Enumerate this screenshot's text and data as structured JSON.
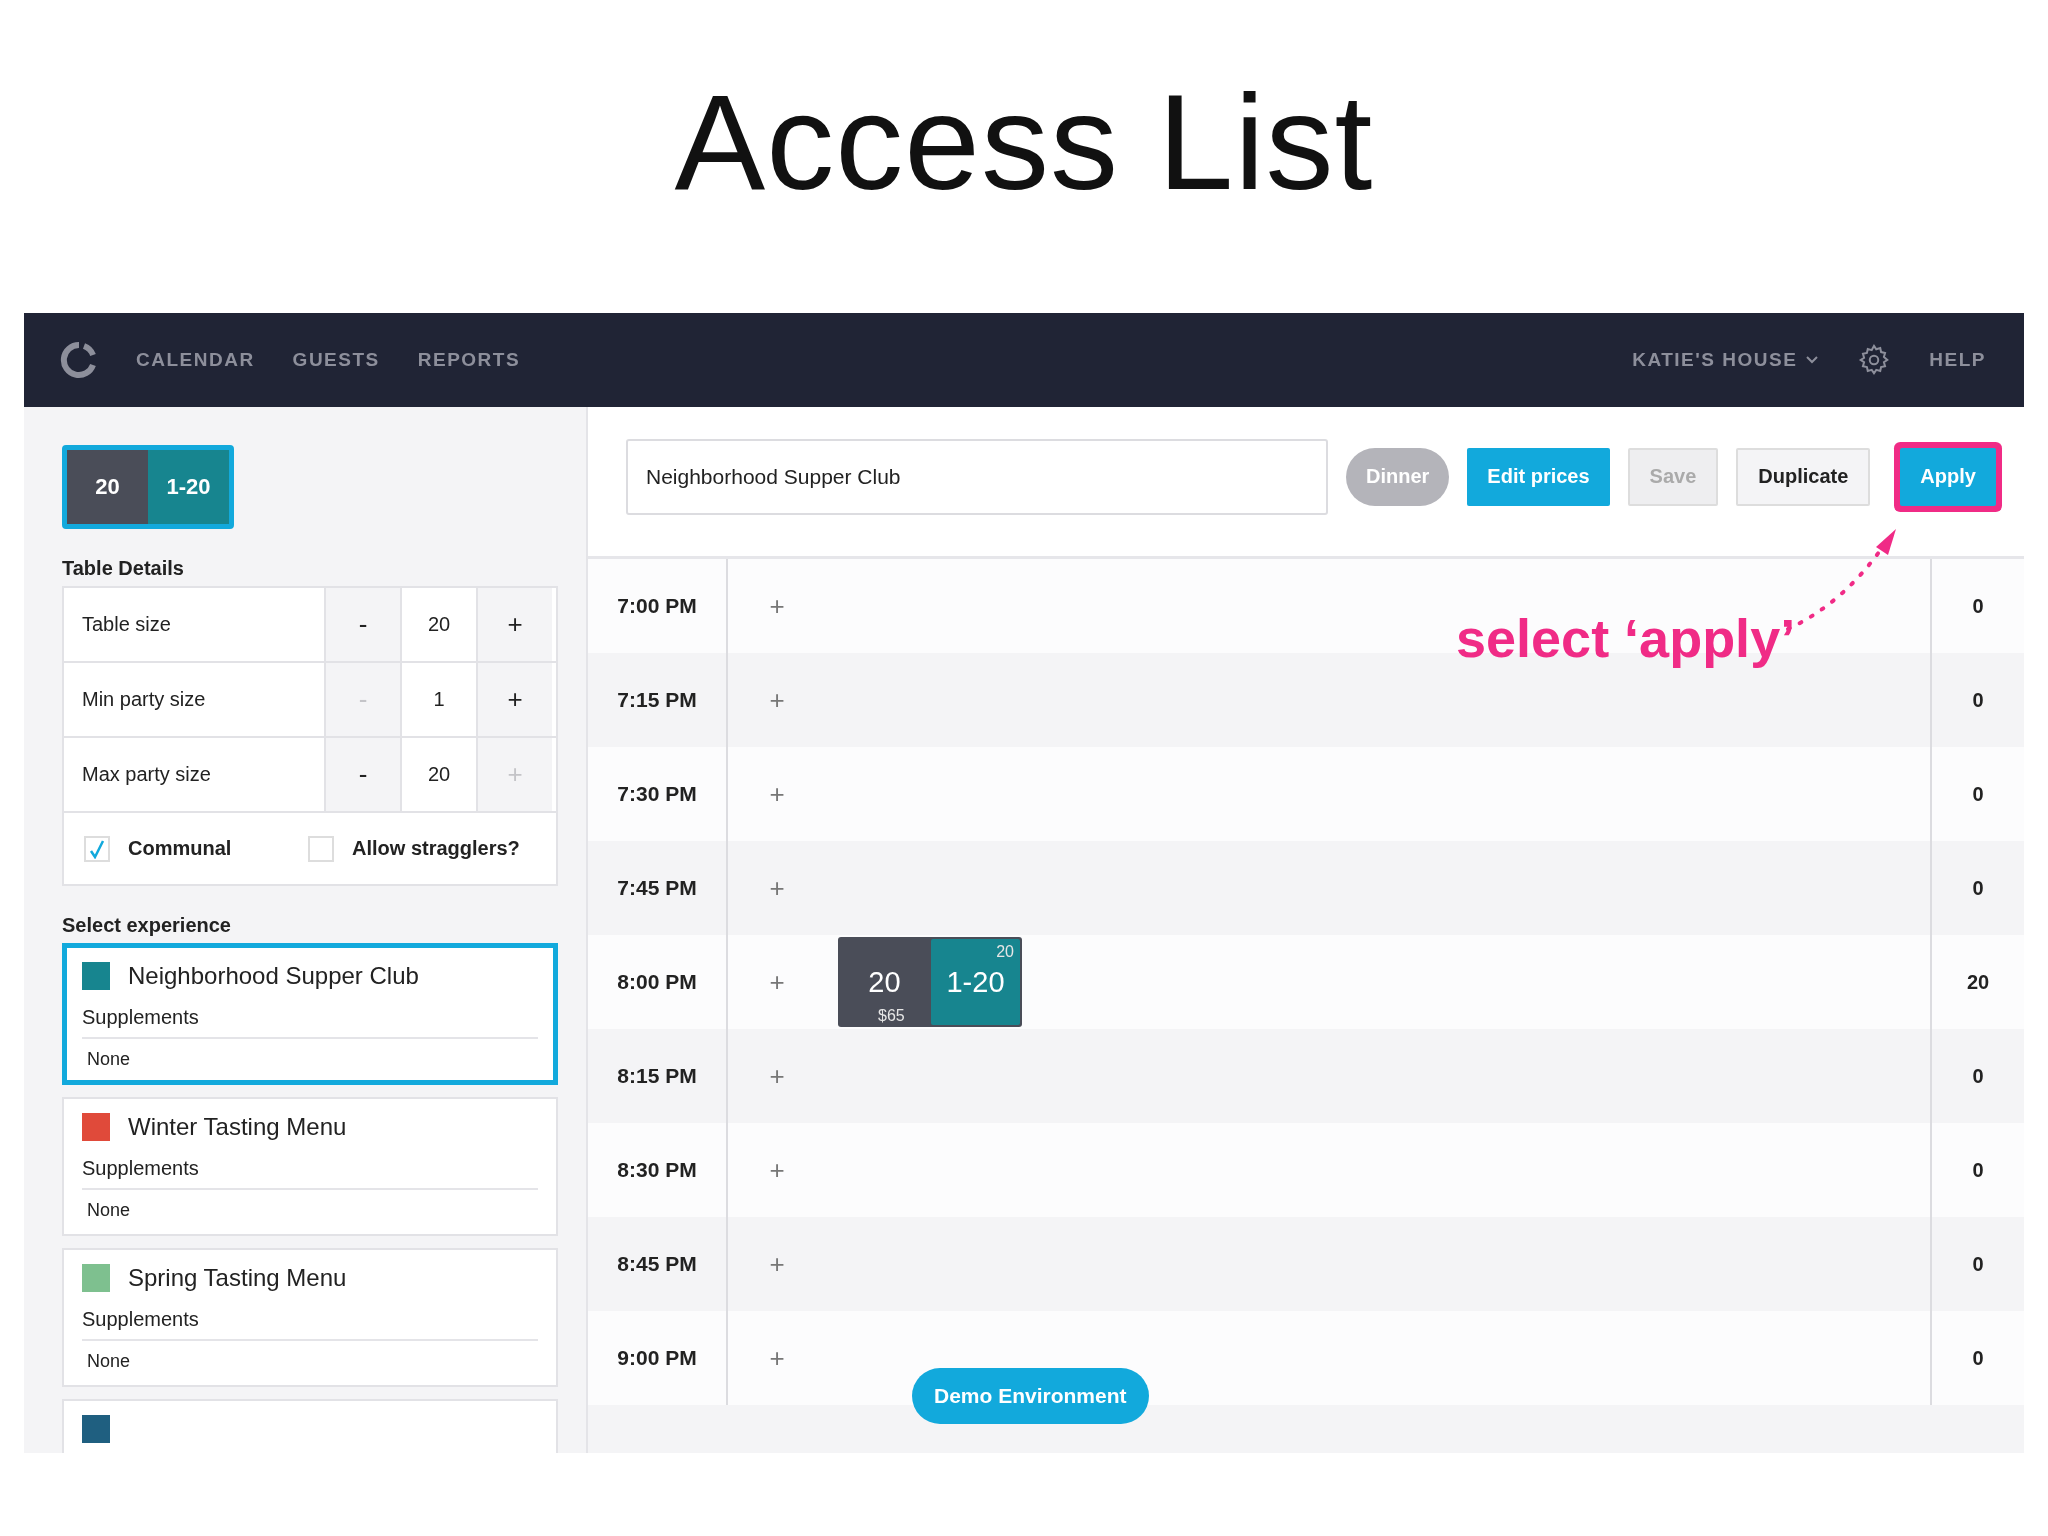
{
  "slide_title": "Access List",
  "nav": {
    "items": [
      "CALENDAR",
      "GUESTS",
      "REPORTS"
    ],
    "venue": "KATIE'S HOUSE",
    "help": "HELP"
  },
  "sidebar": {
    "badge": {
      "size": "20",
      "range": "1-20"
    },
    "table_details": {
      "heading": "Table Details",
      "rows": [
        {
          "label": "Table size",
          "minus": "-",
          "value": "20",
          "plus": "+",
          "minus_disabled": false,
          "plus_disabled": false
        },
        {
          "label": "Min party size",
          "minus": "-",
          "value": "1",
          "plus": "+",
          "minus_disabled": true,
          "plus_disabled": false
        },
        {
          "label": "Max party size",
          "minus": "-",
          "value": "20",
          "plus": "+",
          "minus_disabled": false,
          "plus_disabled": true
        }
      ],
      "checkboxes": [
        {
          "label": "Communal",
          "checked": true
        },
        {
          "label": "Allow stragglers?",
          "checked": false
        }
      ]
    },
    "experiences": {
      "heading": "Select experience",
      "items": [
        {
          "name": "Neighborhood Supper Club",
          "color": "#17858f",
          "selected": true,
          "supplements_label": "Supplements",
          "supplements_value": "None"
        },
        {
          "name": "Winter Tasting Menu",
          "color": "#e04a3a",
          "selected": false,
          "supplements_label": "Supplements",
          "supplements_value": "None"
        },
        {
          "name": "Spring Tasting Menu",
          "color": "#7ec08f",
          "selected": false,
          "supplements_label": "Supplements",
          "supplements_value": "None"
        },
        {
          "color": "#1f5f80",
          "selected": false
        }
      ]
    }
  },
  "main": {
    "name_field": {
      "value": "Neighborhood Supper Club"
    },
    "buttons": [
      {
        "label": "Dinner",
        "kind": "pill"
      },
      {
        "label": "Edit prices",
        "kind": "primary"
      },
      {
        "label": "Save",
        "kind": "disabled"
      },
      {
        "label": "Duplicate",
        "kind": "secondary"
      },
      {
        "label": "Apply",
        "kind": "highlighted"
      }
    ],
    "slots": [
      {
        "time": "7:00 PM",
        "add": "+",
        "count": "0"
      },
      {
        "time": "7:15 PM",
        "add": "+",
        "count": "0"
      },
      {
        "time": "7:30 PM",
        "add": "+",
        "count": "0"
      },
      {
        "time": "7:45 PM",
        "add": "+",
        "count": "0"
      },
      {
        "time": "8:00 PM",
        "add": "+",
        "count": "20",
        "block": {
          "size": "20",
          "price": "$65",
          "range": "1-20",
          "capacity": "20"
        }
      },
      {
        "time": "8:15 PM",
        "add": "+",
        "count": "0"
      },
      {
        "time": "8:30 PM",
        "add": "+",
        "count": "0"
      },
      {
        "time": "8:45 PM",
        "add": "+",
        "count": "0"
      },
      {
        "time": "9:00 PM",
        "add": "+",
        "count": "0"
      }
    ]
  },
  "annotation": "select ‘apply’",
  "demo_badge": "Demo Environment"
}
